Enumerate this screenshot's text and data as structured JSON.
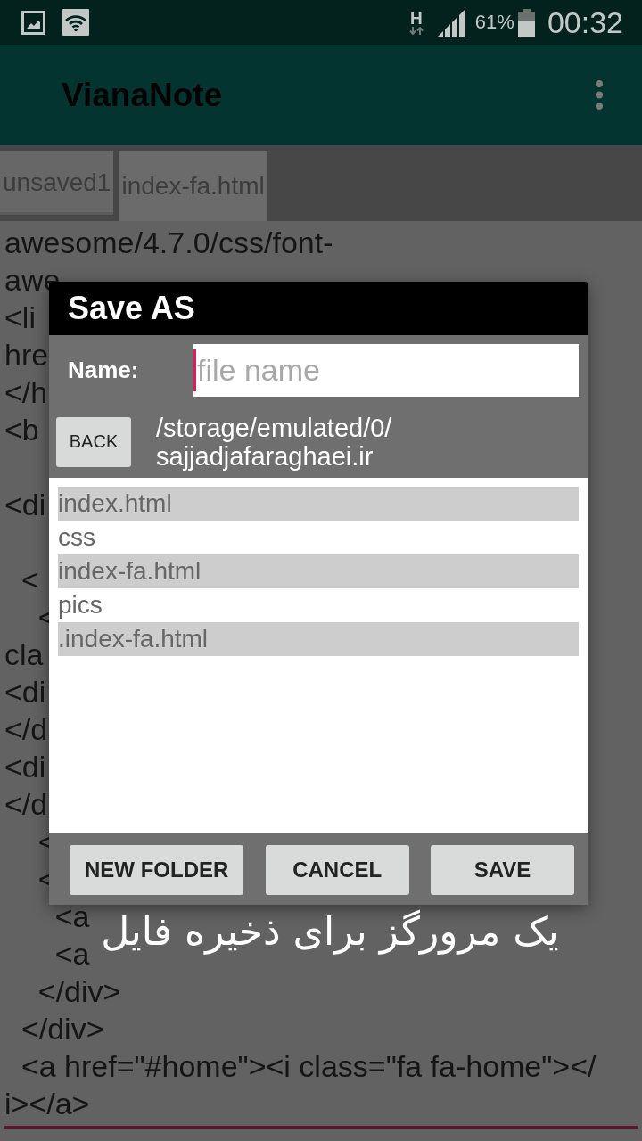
{
  "status_bar": {
    "network": "H",
    "battery": "61%",
    "time": "00:32"
  },
  "app_bar": {
    "title": "VianaNote"
  },
  "tabs": [
    {
      "label": "unsaved1",
      "selected": false
    },
    {
      "label": "index-fa.html",
      "selected": true
    }
  ],
  "editor": {
    "lines": [
      {
        "kind": "code",
        "text": "awesome/4.7.0/css/font-"
      },
      {
        "kind": "code",
        "text": "awe"
      },
      {
        "kind": "code",
        "text": "<li"
      },
      {
        "kind": "code",
        "text": "hre"
      },
      {
        "kind": "code",
        "text": "</h"
      },
      {
        "kind": "code",
        "text": "<b"
      },
      {
        "kind": "blank"
      },
      {
        "kind": "code",
        "text": "<di"
      },
      {
        "kind": "blank"
      },
      {
        "kind": "code",
        "text": "  <"
      },
      {
        "kind": "code",
        "text": "    <"
      },
      {
        "kind": "code",
        "text": "cla"
      },
      {
        "kind": "code",
        "text": "<di"
      },
      {
        "kind": "code",
        "text": "</d"
      },
      {
        "kind": "code",
        "text": "<di"
      },
      {
        "kind": "code",
        "text": "</d"
      },
      {
        "kind": "code",
        "text": "    <"
      },
      {
        "kind": "code",
        "text": "    <"
      },
      {
        "kind": "code",
        "text": "      <a"
      },
      {
        "kind": "code",
        "text": "      <a"
      },
      {
        "kind": "code",
        "text": "    </div>"
      },
      {
        "kind": "code",
        "text": "  </div>"
      },
      {
        "kind": "code",
        "text": "  <a href=\"#home\"><i class=\"fa fa-home\"></"
      },
      {
        "kind": "code",
        "text": "i></a>"
      }
    ]
  },
  "dialog": {
    "title": "Save AS",
    "name_label": "Name:",
    "name_field": {
      "placeholder": "file name"
    },
    "back_button": "BACK",
    "path": "/storage/emulated/0/sajjadjafaraghaei.ir",
    "files": [
      {
        "name": "index.html",
        "kind": "file"
      },
      {
        "name": "css",
        "kind": "folder"
      },
      {
        "name": "index-fa.html",
        "kind": "file"
      },
      {
        "name": "pics",
        "kind": "folder"
      },
      {
        "name": ".index-fa.html",
        "kind": "file"
      }
    ],
    "buttons": [
      "NEW FOLDER",
      "CANCEL",
      "SAVE"
    ]
  },
  "caption": "یک مرورگز برای ذخیره فایل"
}
